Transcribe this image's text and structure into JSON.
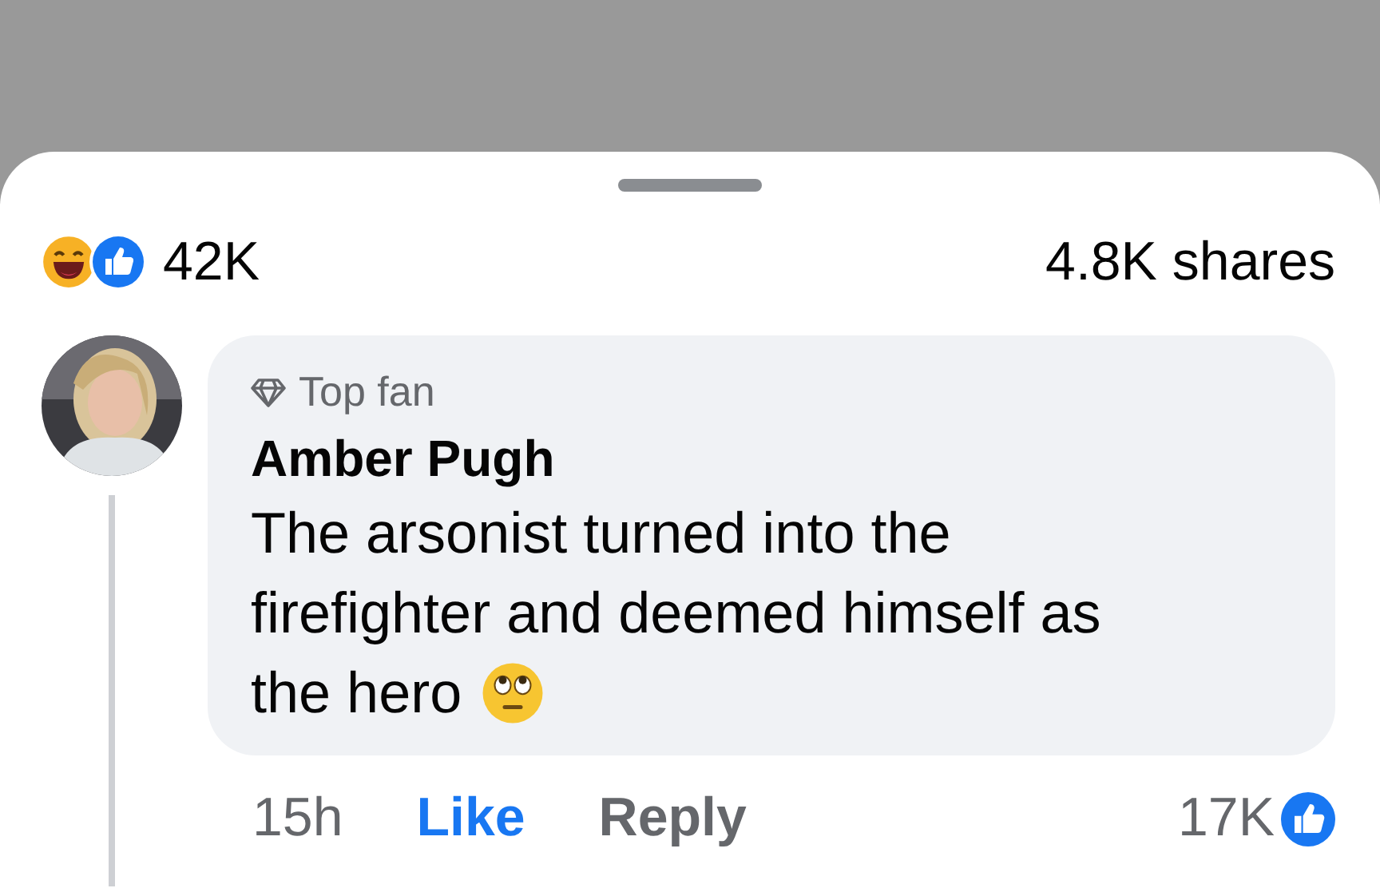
{
  "post_stats": {
    "reaction_count": "42K",
    "shares": "4.8K shares"
  },
  "comment": {
    "badge": "Top fan",
    "author": "Amber Pugh",
    "text_lines": [
      "The arsonist turned into the",
      "firefighter and deemed himself as",
      "the hero"
    ],
    "time": "15h",
    "like_label": "Like",
    "liked": true,
    "reply_label": "Reply",
    "like_count": "17K"
  }
}
